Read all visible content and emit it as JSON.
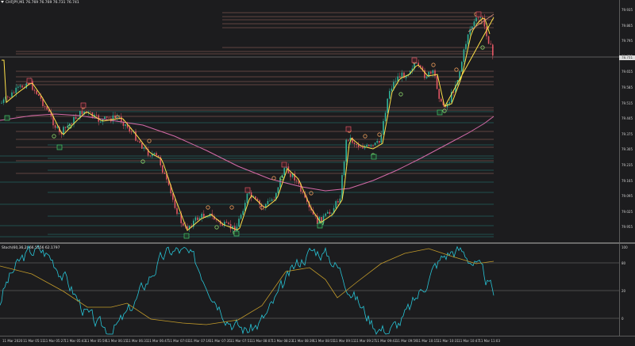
{
  "header": {
    "symbol_timeframe": "CHFJPY,M1",
    "ohlc": "76.769 76.769 76.731 76.741"
  },
  "oscillator": {
    "title": "Stoch(60,36,2) 66.5556 62.1797"
  },
  "price_axis": {
    "labels": [
      "79.935",
      "79.865",
      "79.795",
      "79.725",
      "79.655",
      "79.585",
      "79.515",
      "79.445",
      "79.375",
      "79.305",
      "79.235",
      "79.165",
      "79.095",
      "79.025",
      "79.955"
    ],
    "current_price": "78.741"
  },
  "osc_axis": {
    "labels": [
      "100",
      "80",
      "20",
      "0"
    ]
  },
  "time_axis": {
    "labels": [
      "11 Mar 2020",
      "11 Mar 05:11",
      "11 Mar 05:27",
      "11 Mar 05:43",
      "11 Mar 05:59",
      "11 Mar 06:15",
      "11 Mar 06:31",
      "11 Mar 06:47",
      "11 Mar 07:03",
      "11 Mar 07:19",
      "11 Mar 07:35",
      "11 Mar 07:51",
      "11 Mar 08:07",
      "11 Mar 08:23",
      "11 Mar 08:39",
      "11 Mar 08:55",
      "11 Mar 09:11",
      "11 Mar 09:27",
      "11 Mar 09:43",
      "11 Mar 09:59",
      "11 Mar 10:15",
      "11 Mar 10:31",
      "11 Mar 10:47",
      "11 Mar 11:03"
    ]
  },
  "colors": {
    "background": "#1c1c1e",
    "bull_candle": "#2fb39a",
    "bear_candle": "#e05563",
    "fast_ma": "#ffe14a",
    "slow_ma": "#d46aa8",
    "stoch_main": "#27c4d6",
    "stoch_signal": "#c29a2a",
    "resistance": "#d28a7a",
    "support": "#2a9e94"
  }
}
